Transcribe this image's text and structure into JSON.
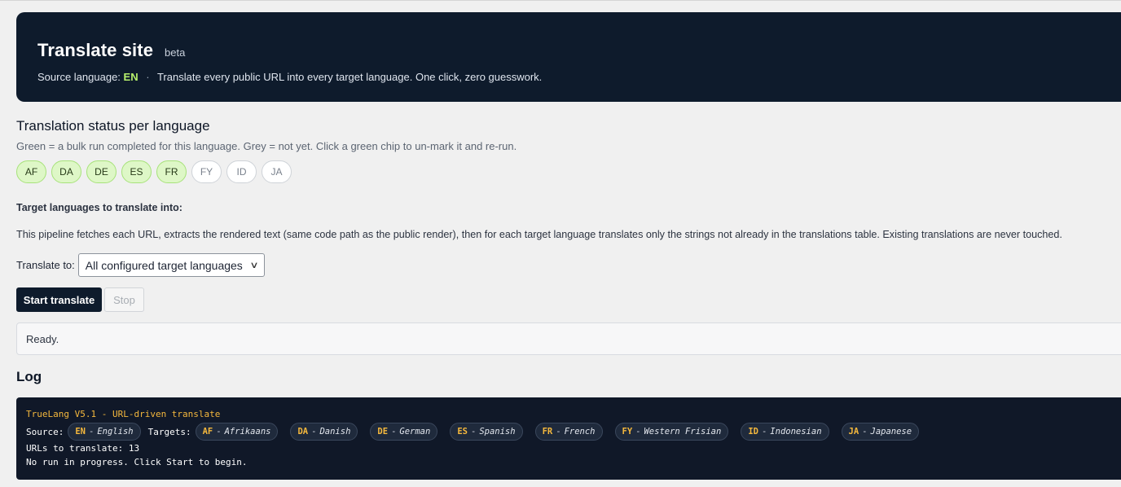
{
  "hero": {
    "title": "Translate site",
    "badge": "beta",
    "source_label": "Source language:",
    "source_code": "EN",
    "separator": "·",
    "tagline": "Translate every public URL into every target language. One click, zero guesswork."
  },
  "status": {
    "heading": "Translation status per language",
    "description": "Green = a bulk run completed for this language. Grey = not yet. Click a green chip to un-mark it and re-run.",
    "chips": [
      {
        "code": "AF",
        "done": true
      },
      {
        "code": "DA",
        "done": true
      },
      {
        "code": "DE",
        "done": true
      },
      {
        "code": "ES",
        "done": true
      },
      {
        "code": "FR",
        "done": true
      },
      {
        "code": "FY",
        "done": false
      },
      {
        "code": "ID",
        "done": false
      },
      {
        "code": "JA",
        "done": false
      }
    ]
  },
  "targets": {
    "label": "Target languages to translate into:",
    "description": "This pipeline fetches each URL, extracts the rendered text (same code path as the public render), then for each target language translates only the strings not already in the translations table. Existing translations are never touched.",
    "translate_to_label": "Translate to:",
    "select_value": "All configured target languages"
  },
  "actions": {
    "start_label": "Start translate",
    "stop_label": "Stop"
  },
  "status_box": {
    "text": "Ready."
  },
  "log": {
    "heading": "Log",
    "title_line": "TrueLang V5.1 - URL-driven translate",
    "source_label": "Source:",
    "targets_label": "Targets:",
    "source": {
      "code": "EN",
      "name": "English"
    },
    "targets": [
      {
        "code": "AF",
        "name": "Afrikaans"
      },
      {
        "code": "DA",
        "name": "Danish"
      },
      {
        "code": "DE",
        "name": "German"
      },
      {
        "code": "ES",
        "name": "Spanish"
      },
      {
        "code": "FR",
        "name": "French"
      },
      {
        "code": "FY",
        "name": "Western Frisian"
      },
      {
        "code": "ID",
        "name": "Indonesian"
      },
      {
        "code": "JA",
        "name": "Japanese"
      }
    ],
    "urls_line": "URLs to translate: 13",
    "run_line": "No run in progress. Click Start to begin."
  },
  "colors": {
    "hero_bg": "#0e1b2c",
    "chip_done_bg": "#def7c7",
    "log_bg": "#101828",
    "log_accent": "#f5b83d",
    "source_code": "#b6f06c"
  }
}
